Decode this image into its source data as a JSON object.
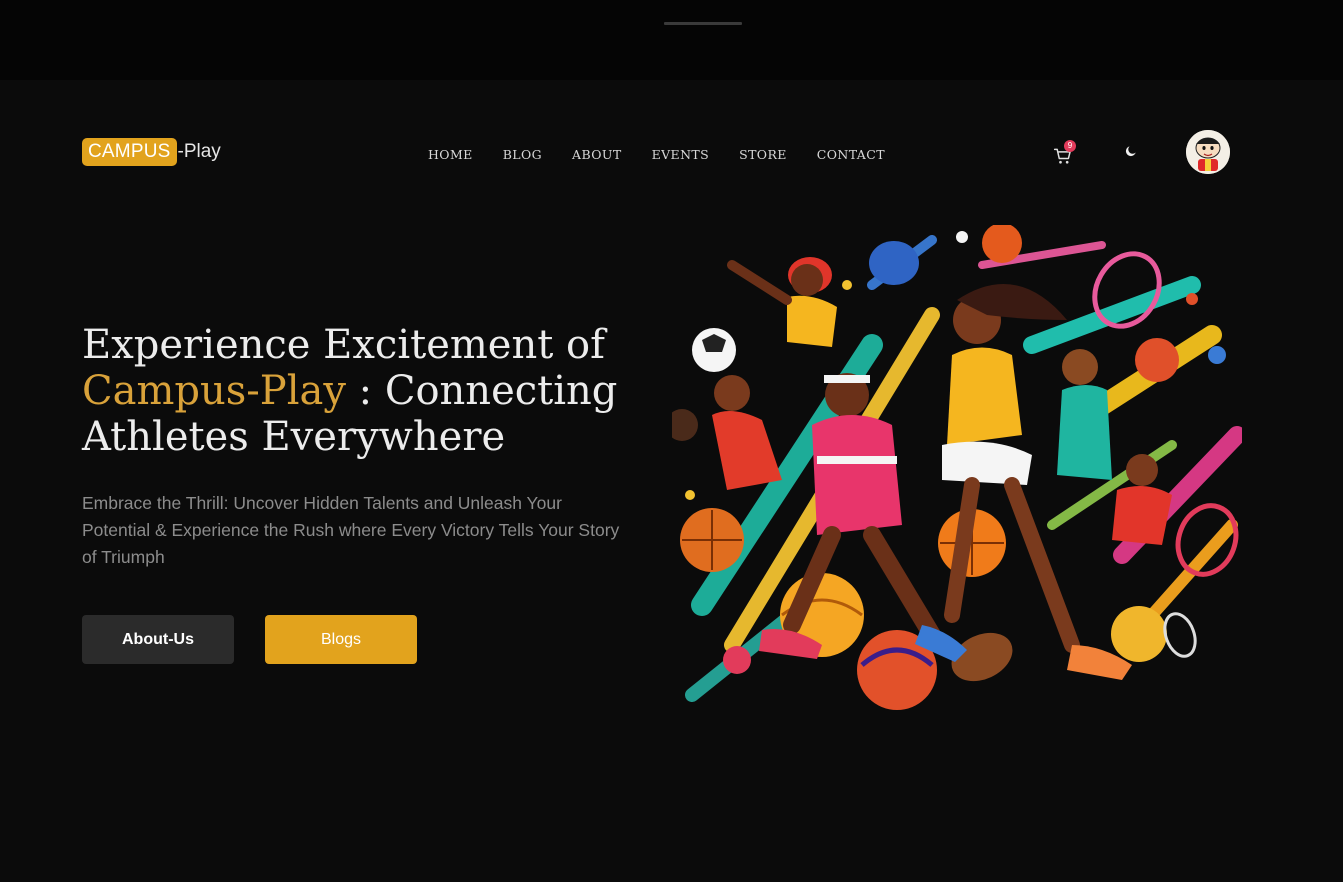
{
  "logo": {
    "badge": "CAMPUS",
    "rest": "-Play"
  },
  "nav": {
    "items": [
      "HOME",
      "BLOG",
      "ABOUT",
      "EVENTS",
      "STORE",
      "CONTACT"
    ]
  },
  "cart": {
    "count": "9"
  },
  "hero": {
    "title_line1": "Experience Excitement of",
    "title_accent": "Campus-Play",
    "title_rest": " : Connecting",
    "title_line3": "Athletes Everywhere",
    "subtitle": "Embrace the Thrill: Uncover Hidden Talents and Unleash Your Potential & Experience the Rush where Every Victory Tells Your Story of Triumph"
  },
  "buttons": {
    "about": "About-Us",
    "blogs": "Blogs"
  },
  "colors": {
    "accent": "#e2a31d",
    "background": "#0b0b0b",
    "badge": "#e23b5b"
  },
  "icons": [
    "cart-icon",
    "moon-icon",
    "avatar"
  ]
}
